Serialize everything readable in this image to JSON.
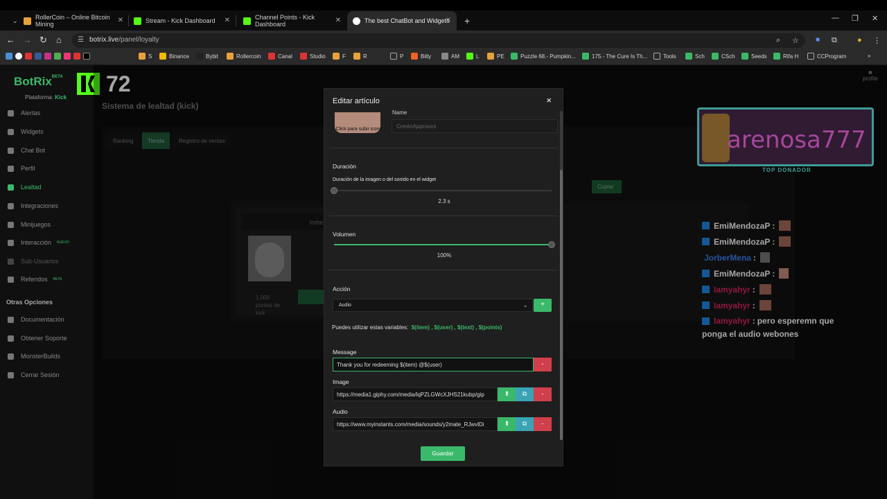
{
  "browser": {
    "tabs": [
      {
        "label": "RollerCoin – Online Bitcoin Mining",
        "color": "#e8a23a"
      },
      {
        "label": "Stream - Kick Dashboard",
        "color": "#53fc18"
      },
      {
        "label": "Channel Points - Kick Dashboard",
        "color": "#53fc18"
      },
      {
        "label": "The best ChatBot and Widgets",
        "color": "#ffffff"
      }
    ],
    "new_tab": "+",
    "url_domain": "botrix.live",
    "url_path": "/panel/loyalty",
    "bookmarks": [
      "S",
      "Binance",
      "Bybit",
      "Rollercoin",
      "Canal",
      "Studio",
      "F",
      "R",
      "P",
      "Bitly",
      "AM",
      "L",
      "PE",
      "Puzzle 68.- Pumpkin...",
      "175.- The Cure Is Th...",
      "Tools",
      "Sch",
      "CSch",
      "Seeds",
      "Rifa H",
      "CCProgram"
    ]
  },
  "sidebar": {
    "logo": "BotRix",
    "logo_badge": "BETA",
    "platform_label": "Plataforma:",
    "platform_value": "Kick",
    "items": [
      {
        "label": "Alertas",
        "tag": ""
      },
      {
        "label": "Widgets",
        "tag": ""
      },
      {
        "label": "Chat Bot",
        "tag": ""
      },
      {
        "label": "Perfil",
        "tag": ""
      },
      {
        "label": "Lealtad",
        "tag": ""
      },
      {
        "label": "Integraciones",
        "tag": ""
      },
      {
        "label": "Minijuegos",
        "tag": "NUEVO"
      },
      {
        "label": "Interacción",
        "tag": ""
      },
      {
        "label": "Sub-Usuarios",
        "tag": ""
      },
      {
        "label": "Referidos",
        "tag": "BETA"
      }
    ],
    "section_title": "Otras Opciones",
    "other_items": [
      {
        "label": "Documentación"
      },
      {
        "label": "Obtener Soporte"
      },
      {
        "label": "MonsterBuilds"
      },
      {
        "label": "Cerrar Sesión"
      }
    ]
  },
  "viewer_count": "72",
  "page": {
    "title": "Sistema de lealtad (kick)",
    "tabs": [
      "Ranking",
      "Tienda",
      "Registro de ventas"
    ],
    "active_tab": "Tienda",
    "copy_button": "Copiar",
    "item_title": "Imbec",
    "item_points": "1,000 puntos de kick",
    "profile": "profile"
  },
  "modal": {
    "title": "Editar artículo",
    "close": "×",
    "image_hint": "Click para subir icono",
    "name_label": "Name",
    "name_value": "CrestoApproves",
    "duration_label": "Duración",
    "duration_hint": "Duración de la imagen o del sonido en el widget",
    "duration_value": "2.3 s",
    "duration_fraction": 0.0,
    "volume_label": "Volumen",
    "volume_value": "100%",
    "volume_fraction": 1.0,
    "action_label": "Acción",
    "action_selected": "Audio",
    "add_label": "+",
    "vars_prefix": "Puedes utilizar estas variables:",
    "vars": [
      "$(item)",
      "$(user)",
      "$(text)",
      "$(points)"
    ],
    "message_label": "Message",
    "message_value": "Thank you for redeeming $(item) @$(user)",
    "image_label": "Image",
    "image_value": "https://media1.giphy.com/media/lqPZLGWcXJHS21kubp/gip",
    "audio_label": "Audio",
    "audio_value": "https://www.myinstants.com/media/sounds/y2mate_RJwvlDi",
    "remove_label": "-",
    "upload_icon": "upload-icon",
    "library_icon": "library-icon",
    "save_label": "Guardar"
  },
  "stream_overlay": {
    "top_donor_name": "arenosa777",
    "top_donor_label": "TOP DONADOR",
    "chat": [
      {
        "user": "EmiMendozaP",
        "color": "#ffffff",
        "text": ""
      },
      {
        "user": "EmiMendozaP",
        "color": "#ffffff",
        "text": ""
      },
      {
        "user": "JorberMena",
        "color": "#3b82f6",
        "text": ""
      },
      {
        "user": "EmiMendozaP",
        "color": "#ffffff",
        "text": ""
      },
      {
        "user": "Iamyahyr",
        "color": "#e0245e",
        "text": ""
      },
      {
        "user": "Iamyahyr",
        "color": "#e0245e",
        "text": ""
      },
      {
        "user": "Iamyahyr",
        "color": "#e0245e",
        "text": "pero esperemn que"
      }
    ],
    "chat_continuation": "ponga el audio webones"
  },
  "colors": {
    "accent": "#3bb96a",
    "danger": "#d03f4c",
    "info": "#3aa3b5",
    "kick": "#53fc18"
  }
}
